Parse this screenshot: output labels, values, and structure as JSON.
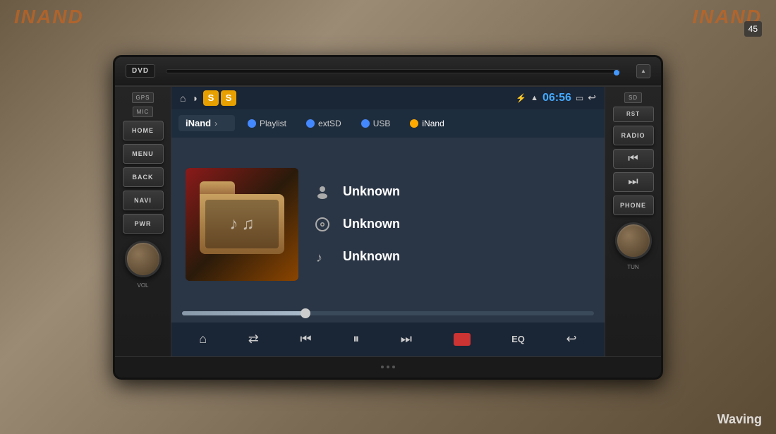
{
  "watermark": {
    "left": "iNand",
    "right": "iNand",
    "bottom": "Waving"
  },
  "price": "45",
  "dvd": {
    "label": "DVD",
    "eject": "▲"
  },
  "left_panel": {
    "gps": "GPS",
    "mic": "MIC",
    "buttons": [
      "HOME",
      "MENU",
      "BACK",
      "NAVI",
      "PWR"
    ],
    "knob_label": "VOL"
  },
  "right_panel": {
    "sd": "SD",
    "rst": "RST",
    "buttons": [
      "RADIO",
      "PHONE"
    ],
    "knob_label": "TUN"
  },
  "status_bar": {
    "clock": "06:56"
  },
  "source_tabs": {
    "inand_label": "iNand",
    "tabs": [
      {
        "label": "Playlist",
        "color": "#4488ff"
      },
      {
        "label": "extSD",
        "color": "#4488ff"
      },
      {
        "label": "USB",
        "color": "#4488ff"
      },
      {
        "label": "iNand",
        "color": "#ffaa00"
      }
    ]
  },
  "track_info": {
    "artist": "Unknown",
    "album": "Unknown",
    "title": "Unknown"
  },
  "controls": {
    "home": "⌂",
    "shuffle": "⇄",
    "prev": "⏮",
    "play_pause": "⏸",
    "next": "⏭",
    "eq": "EQ",
    "back": "↩"
  }
}
